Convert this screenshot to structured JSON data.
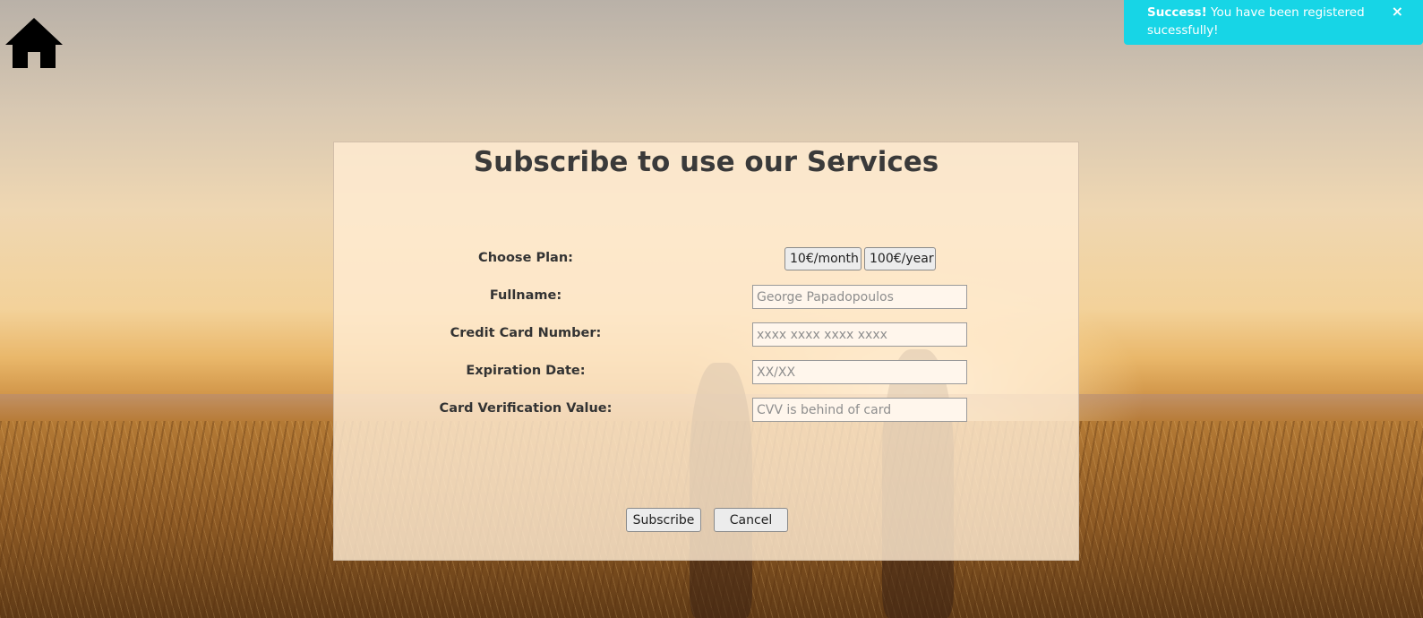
{
  "alert": {
    "strong": "Success!",
    "message": " You have been registered sucessfully!",
    "close": "×",
    "color": "#17d5e6"
  },
  "home_icon": "home-icon",
  "form": {
    "title": "Subscribe to use our Services",
    "plan_label": "Choose Plan:",
    "plans": [
      "10€/month",
      "100€/year"
    ],
    "fullname_label": "Fullname:",
    "fullname_placeholder": "George Papadopoulos",
    "card_label": "Credit Card Number:",
    "card_placeholder": "xxxx xxxx xxxx xxxx",
    "expiry_label": "Expiration Date:",
    "expiry_placeholder": "XX/XX",
    "cvv_label": "Card Verification Value:",
    "cvv_placeholder": "CVV is behind of card",
    "subscribe": "Subscribe",
    "cancel": "Cancel"
  }
}
